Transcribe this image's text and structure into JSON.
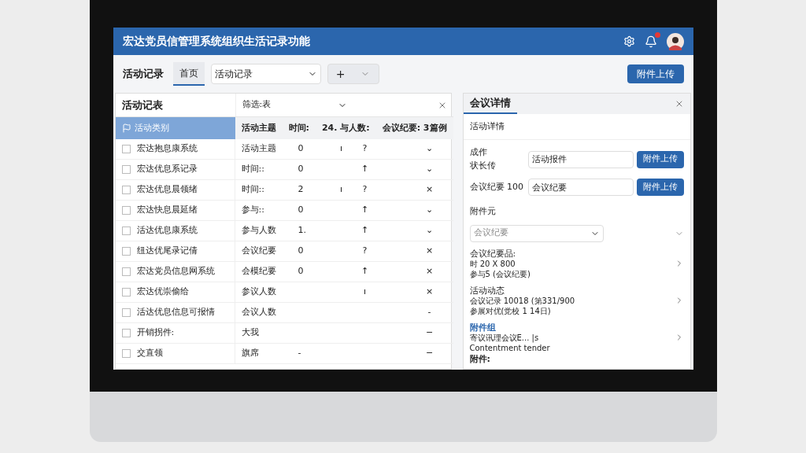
{
  "header": {
    "title": "宏达党员信管理系统组织生活记录功能",
    "notifications": true
  },
  "toolbar": {
    "label": "活动记录",
    "tabs": [
      {
        "label": "首页",
        "selected": true
      }
    ],
    "select": {
      "value": "活动记录"
    },
    "add_button": "+",
    "upload_button": "附件上传"
  },
  "left_panel": {
    "title": "活动记表",
    "filter": "筛选:表",
    "selected_item": {
      "label": "活动类别",
      "selected": true
    },
    "summary": [
      "活动主题",
      "时间:",
      "24. 与人数:",
      "会议纪要: 3篇例"
    ],
    "rows": [
      {
        "name": "宏达抱息康系统",
        "column_2": "活动主题",
        "column_3": "0",
        "column_4": "ı",
        "column_5": "?",
        "action": "⌄",
        "checked": false
      },
      {
        "name": "宏达优息系记录",
        "column_2": "时间::",
        "column_3": "0",
        "column_4": "",
        "column_5": "↑",
        "action": "⌄",
        "checked": false
      },
      {
        "name": "宏达优息晨领绪",
        "column_2": "时间::",
        "column_3": "2",
        "column_4": "ı",
        "column_5": "?",
        "action": "×",
        "checked": false
      },
      {
        "name": "宏达快息晨延绪",
        "column_2": "参与::",
        "column_3": "0",
        "column_4": "",
        "column_5": "↑",
        "action": "⌄",
        "checked": false
      },
      {
        "name": "活达优息康系统",
        "column_2": "参与人数",
        "column_3": "1.",
        "column_4": "",
        "column_5": "↑",
        "action": "⌄",
        "checked": false
      },
      {
        "name": "纽达优尾录记倩",
        "column_2": "会议纪要",
        "column_3": "0",
        "column_4": "",
        "column_5": "?",
        "action": "×",
        "checked": false
      },
      {
        "name": "宏达党员信息网系统",
        "column_2": "会模纪要",
        "column_3": "0",
        "column_4": "",
        "column_5": "↑",
        "action": "×",
        "checked": false
      },
      {
        "name": "宏达优崇偷给",
        "column_2": "参议人数",
        "column_3": "",
        "column_4": "",
        "column_5": "ı",
        "action": "×",
        "checked": false
      },
      {
        "name": "活达优息信息可报情",
        "column_2": "会议人数",
        "column_3": "",
        "column_4": "",
        "column_5": "",
        "action": "-",
        "checked": false
      },
      {
        "name": "开销拐件:",
        "column_2": "大我",
        "column_3": "",
        "column_4": "",
        "column_5": "",
        "action": "−",
        "checked": false
      },
      {
        "name": "交直领",
        "column_2": "旗席",
        "column_3": "-",
        "column_4": "",
        "column_5": "",
        "action": "−",
        "checked": false
      }
    ]
  },
  "right_panel": {
    "tab": {
      "label": "会议详情",
      "selected": true
    },
    "section": "活动详情",
    "form": [
      {
        "label": [
          "成作",
          "状长传"
        ],
        "value": "活动报件",
        "button": "附件上传"
      },
      {
        "label": [
          "会议纪要 100"
        ],
        "value": "会议纪要",
        "button": "附件上传"
      }
    ],
    "attachments_label": "附件元",
    "select": {
      "placeholder": "会议纪要"
    },
    "items": [
      {
        "title": "会议纪要品:",
        "lines": [
          "时 20 X 800",
          "参与5 (会议纪要)"
        ],
        "highlight": false
      },
      {
        "title": "活动动态",
        "lines": [
          "会议记录 10018 (第331/900",
          "参展对优(党校 1 14日)"
        ],
        "highlight": false
      },
      {
        "title": "附件组",
        "lines": [
          "寄议讯理会议E... |s",
          "Contentment tender"
        ],
        "highlight": true
      }
    ],
    "footer": "附件:"
  }
}
